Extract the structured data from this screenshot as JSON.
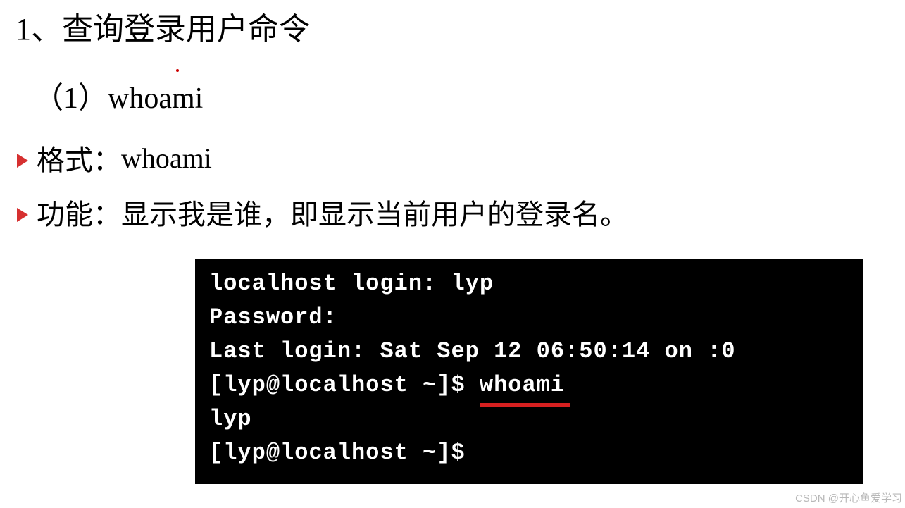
{
  "heading": "1、查询登录用户命令",
  "subheading": "（1）whoami",
  "bullets": [
    {
      "label": "格式：",
      "value": "whoami"
    },
    {
      "label": "功能：",
      "value": "显示我是谁，即显示当前用户的登录名。"
    }
  ],
  "terminal": {
    "line1": "localhost login: lyp",
    "line2": "Password:",
    "line3": "Last login: Sat Sep 12 06:50:14 on :0",
    "line4_prefix": "[lyp@localhost ~]$ ",
    "line4_cmd": "whoami",
    "line5": "lyp",
    "line6": "[lyp@localhost ~]$"
  },
  "watermark": "CSDN @开心鱼爱学习"
}
